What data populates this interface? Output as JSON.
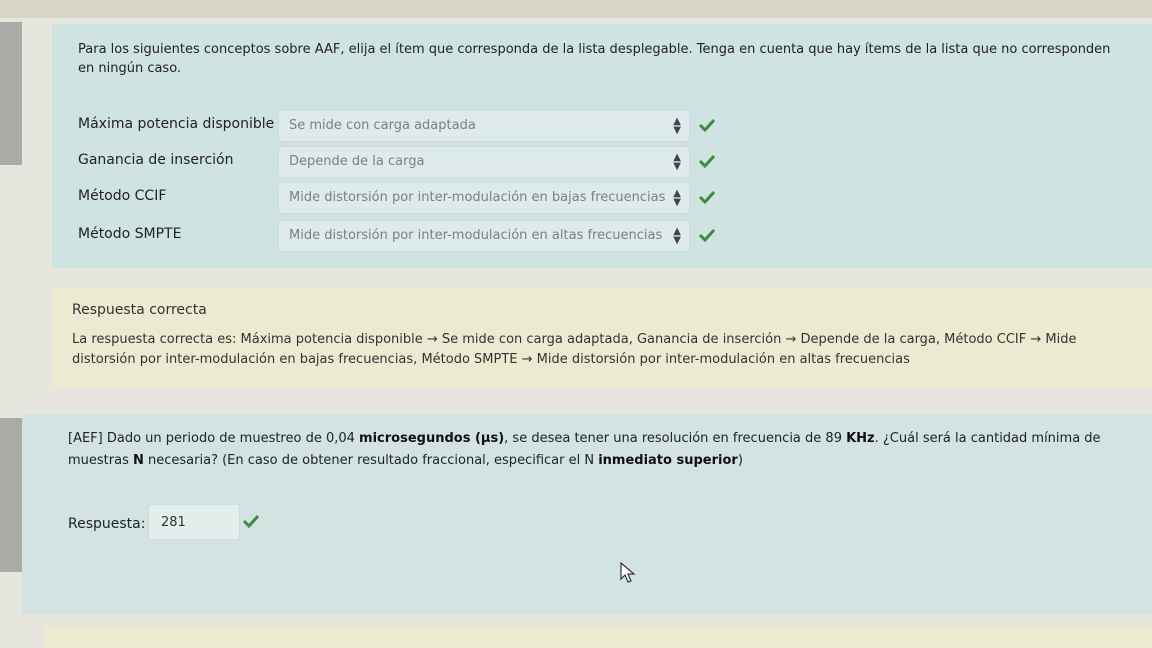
{
  "question1": {
    "prompt": "Para los siguientes conceptos sobre AAF, elija el ítem que corresponda de la lista desplegable. Tenga en cuenta que hay ítems de la lista que no corresponden en ningún caso.",
    "rows": [
      {
        "label": "Máxima potencia disponible",
        "selected": "Se mide con carga adaptada",
        "status": "correct"
      },
      {
        "label": "Ganancia de inserción",
        "selected": "Depende de la carga",
        "status": "correct"
      },
      {
        "label": "Método CCIF",
        "selected": "Mide distorsión por inter-modulación en bajas frecuencias",
        "status": "correct"
      },
      {
        "label": "Método SMPTE",
        "selected": "Mide distorsión por inter-modulación en altas frecuencias",
        "status": "correct"
      }
    ]
  },
  "feedback1": {
    "title": "Respuesta correcta",
    "text": "La respuesta correcta es: Máxima potencia disponible → Se mide con carga adaptada, Ganancia de inserción → Depende de la carga, Método CCIF → Mide distorsión por inter-modulación en bajas frecuencias, Método SMPTE → Mide distorsión por inter-modulación en altas frecuencias"
  },
  "question2": {
    "text_1": "[AEF] Dado un periodo de muestreo de 0,04 ",
    "bold_1": "microsegundos (µs)",
    "text_2": ", se desea tener una resolución en frecuencia de 89 ",
    "bold_2": "KHz",
    "text_3": ". ¿Cuál será la cantidad mínima de muestras ",
    "bold_3": "N",
    "text_4": " necesaria? (En caso de obtener resultado fraccional, especificar el N ",
    "bold_4": "inmediato superior",
    "text_5": ")",
    "answer_label": "Respuesta:",
    "answer_value": "281",
    "status": "correct"
  },
  "colors": {
    "check": "#3c8a3c",
    "question_bg": "#cfe3e2",
    "feedback_bg": "#ecebd1"
  }
}
